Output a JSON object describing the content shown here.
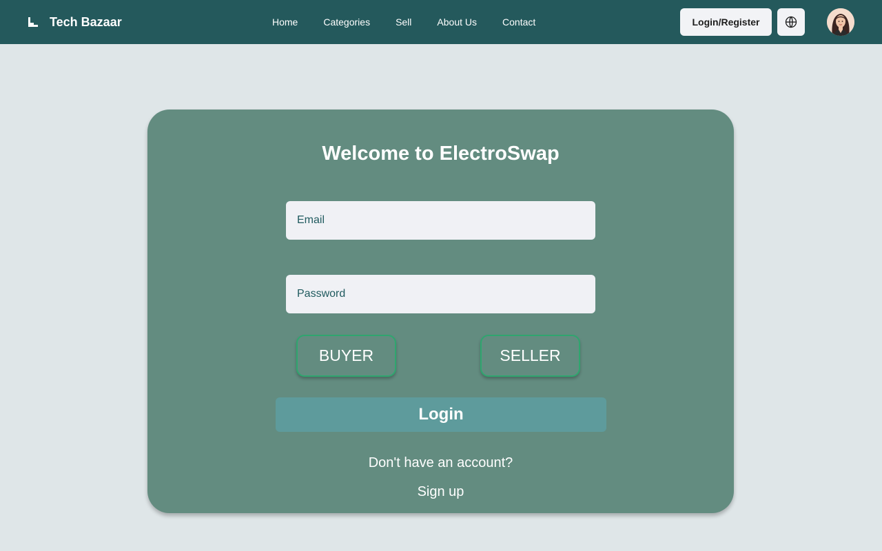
{
  "header": {
    "brand": "Tech Bazaar",
    "brand_icon": "stairs-logo-icon",
    "nav": [
      "Home",
      "Categories",
      "Sell",
      "About Us",
      "Contact"
    ],
    "login_register": "Login/Register",
    "language_icon": "globe-icon",
    "avatar_icon": "user-avatar"
  },
  "colors": {
    "header_bg": "#24595c",
    "page_bg": "#dfe6e8",
    "card_bg": "#638c80",
    "login_button": "#5e9b9c",
    "role_border": "#2fa66f"
  },
  "login_card": {
    "title": "Welcome to ElectroSwap",
    "email_placeholder": "Email",
    "password_placeholder": "Password",
    "buyer": "BUYER",
    "seller": "SELLER",
    "login": "Login",
    "no_account": "Don't have an account?",
    "signup": "Sign up"
  }
}
